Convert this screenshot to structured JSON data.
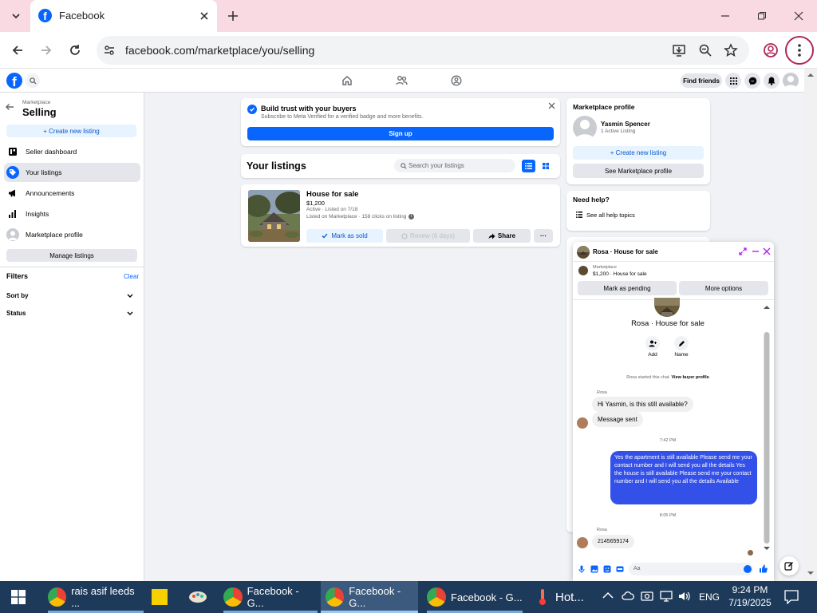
{
  "browser": {
    "tab_title": "Facebook",
    "url": "facebook.com/marketplace/you/selling"
  },
  "fb_header": {
    "find_friends": "Find friends"
  },
  "sidebar": {
    "breadcrumb": "Marketplace",
    "title": "Selling",
    "create_listing": "+ Create new listing",
    "items": [
      {
        "label": "Seller dashboard",
        "icon": "dashboard-icon"
      },
      {
        "label": "Your listings",
        "icon": "tag-icon"
      },
      {
        "label": "Announcements",
        "icon": "megaphone-icon"
      },
      {
        "label": "Insights",
        "icon": "bar-chart-icon"
      },
      {
        "label": "Marketplace profile",
        "icon": "profile-icon"
      }
    ],
    "manage_listings": "Manage listings",
    "filters_label": "Filters",
    "clear_label": "Clear",
    "sort_by": "Sort by",
    "status": "Status"
  },
  "trust_banner": {
    "title": "Build trust with your buyers",
    "subtitle": "Subscribe to Meta Verified for a verified badge and more benefits.",
    "sign_up": "Sign up"
  },
  "listings": {
    "heading": "Your listings",
    "search_placeholder": "Search your listings",
    "item": {
      "title": "House for sale",
      "price": "$1,200",
      "status_line": "Active · Listed on 7/18",
      "stats_line": "Listed on Marketplace · 158 clicks on listing",
      "mark_sold": "Mark as sold",
      "renew": "Renew (6 days)",
      "share": "Share",
      "more": "···"
    }
  },
  "profile_card": {
    "heading": "Marketplace profile",
    "name": "Yasmin Spencer",
    "active": "1 Active Listing",
    "create_listing": "+ Create new listing",
    "see_profile": "See Marketplace profile"
  },
  "help_card": {
    "heading": "Need help?",
    "all_topics": "See all help topics"
  },
  "chat": {
    "header_title": "Rosa · House for sale",
    "sub_source": "Marketplace",
    "sub_item": "$1,200 · House for sale",
    "mark_pending": "Mark as pending",
    "more_options": "More options",
    "contact_name": "Rosa · House for sale",
    "add_label": "Add",
    "name_label": "Name",
    "started_text": "Rosa started this chat.",
    "view_profile": "View buyer profile",
    "sender_1": "Rosa",
    "msg_1": "Hi Yasmin, is this still available?",
    "msg_2": "Message sent",
    "time_1": "7:42 PM",
    "msg_out": "Yes the apartment is still available Please send me your contact number and I will send you all the details Yes the house is still available Please send me your contact number and I will send you all the details Available",
    "time_2": "8:05 PM",
    "sender_2": "Rosa",
    "msg_3": "2145659174",
    "composer_placeholder": "Aa"
  },
  "taskbar": {
    "apps": [
      {
        "label": "rais asif leeds ..."
      },
      {
        "label": "Facebook - G..."
      },
      {
        "label": "Facebook - G..."
      },
      {
        "label": "Facebook - G..."
      }
    ],
    "weather": "Hot...",
    "lang": "ENG",
    "time": "9:24 PM",
    "date": "7/19/2025"
  },
  "colors": {
    "fb_blue": "#0866ff",
    "chat_blue": "#3350e8",
    "tabbar_pink": "#f9d9e2",
    "taskbar": "#1d3a5a"
  }
}
